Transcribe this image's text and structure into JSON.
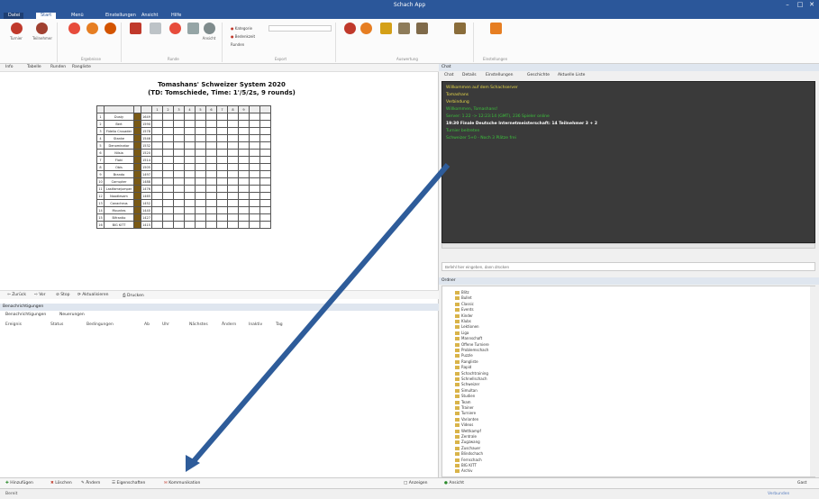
{
  "window": {
    "title": "Schach App"
  },
  "ribbon_tabs": [
    "Datei",
    "Start",
    "Menü",
    "Einstellungen",
    "Ansicht",
    "Hilfe"
  ],
  "ribbon_groups": [
    "Turnier",
    "Teilnehmer",
    "Ergebnisse",
    "Runde",
    "Ansicht",
    "Export",
    "Auswertung",
    "Einstellungen"
  ],
  "ribbon_small": [
    "Kategorie",
    "Bedenkzeit",
    "Runden"
  ],
  "doc_tabs": [
    "Info",
    "Tabelle",
    "Runden",
    "Rangliste"
  ],
  "tournament": {
    "title": "Tomashans' Schweizer System 2020",
    "subtitle": "(TD: Tomschiede, Time: 1'/5/2s, 9 rounds)"
  },
  "crosstable": {
    "header": [
      "",
      "",
      "",
      "",
      "1",
      "2",
      "3",
      "4",
      "5",
      "6",
      "7",
      "8",
      "9",
      "",
      ""
    ],
    "rows": [
      {
        "rank": "1",
        "name": "Dusty",
        "rating": "1649"
      },
      {
        "rank": "2",
        "name": "Bert",
        "rating": "1590"
      },
      {
        "rank": "3",
        "name": "Fidelio Crusader",
        "rating": "1578"
      },
      {
        "rank": "4",
        "name": "Stanke",
        "rating": "1546"
      },
      {
        "rank": "5",
        "name": "Denominator",
        "rating": "1532"
      },
      {
        "rank": "6",
        "name": "Nilsia",
        "rating": "1520"
      },
      {
        "rank": "7",
        "name": "Floki",
        "rating": "1514"
      },
      {
        "rank": "8",
        "name": "Obis",
        "rating": "1505"
      },
      {
        "rank": "9",
        "name": "Brando",
        "rating": "1497"
      },
      {
        "rank": "10",
        "name": "Corrupter",
        "rating": "1488"
      },
      {
        "rank": "11",
        "name": "Lastfamejumper",
        "rating": "1476"
      },
      {
        "rank": "12",
        "name": "Noodlesam",
        "rating": "1465"
      },
      {
        "rank": "13",
        "name": "Canacheus",
        "rating": "1452"
      },
      {
        "rank": "14",
        "name": "Mountes",
        "rating": "1440"
      },
      {
        "rank": "15",
        "name": "Bifrantio",
        "rating": "1427"
      },
      {
        "rank": "16",
        "name": "BIG KITT",
        "rating": "1415"
      }
    ]
  },
  "view_toolbar": [
    "Zurück",
    "Vor",
    "Stop",
    "Aktualisieren",
    "Drucken"
  ],
  "tasks": {
    "header": "Benachrichtigungen",
    "tabs": [
      "Benachrichtigungen",
      "Neuerungen"
    ],
    "columns": [
      "Ereignis",
      "Status",
      "Bedingungen",
      "Ab",
      "Uhr",
      "Nächstes",
      "Ändern",
      "Inaktiv",
      "Tag"
    ]
  },
  "bottom_toolbar": [
    "Hinzufügen",
    "Löschen",
    "Ändern",
    "Eigenschaften",
    "Kommunikation"
  ],
  "bottom_right": "Anzeigen",
  "right": {
    "header": "Chat",
    "chat_tabs": [
      "Chat",
      "Details",
      "Einstellungen",
      "Geschichte",
      "Aktuelle Liste"
    ],
    "console": [
      {
        "text": "Willkommen auf dem Schachserver",
        "color": "y"
      },
      {
        "text": "Tomashans",
        "color": "y"
      },
      {
        "text": "Verbindung",
        "color": "y"
      },
      {
        "text": "Willkommen, Tomashans!",
        "color": "g"
      },
      {
        "text": "Server: 1.22 -> 12:23:14 (GMT), 236 Spieler online",
        "color": "g"
      },
      {
        "text": "19:30 Finale Deutsche Internetmeisterschaft: 14 Teilnehmer 3 + 2",
        "color": "w"
      },
      {
        "text": "Turnier beitreten",
        "color": "g"
      },
      {
        "text": "Schweizer 5+0 - Noch 3 Plätze frei",
        "color": "g"
      }
    ],
    "command_placeholder": "Befehl hier eingeben, dann drücken",
    "tree_header": "Ordner",
    "tree_items": [
      "Blitz",
      "Bullet",
      "Classic",
      "Events",
      "Kinder",
      "Klubs",
      "Lektionen",
      "Liga",
      "Mannschaft",
      "Offene Turniere",
      "Problemschach",
      "Puzzle",
      "Rangliste",
      "Rapid",
      "Schachtraining",
      "Schnellschach",
      "Schweizer",
      "Simultan",
      "Studien",
      "Team",
      "Trainer",
      "Turniere",
      "Varianten",
      "Videos",
      "Wettkampf",
      "Zentrale",
      "Zugzwang",
      "Zuschauer",
      "Blindschach",
      "Fernschach",
      "BIG KITT",
      "Archiv"
    ],
    "bottom": "Ansicht",
    "bottom_right": "Gast"
  },
  "status": {
    "left": "Bereit",
    "right": "Verbunden"
  },
  "colors": {
    "accent": "#2b579a",
    "arrow": "#2e5c9a"
  }
}
